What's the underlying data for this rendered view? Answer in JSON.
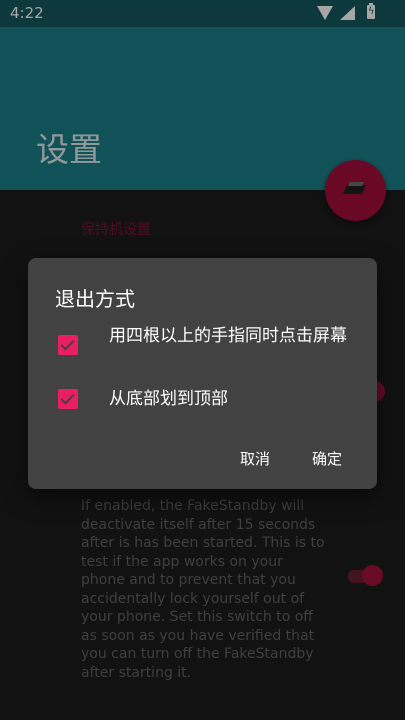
{
  "status_bar": {
    "time": "4:22"
  },
  "app_bar": {
    "title": "设置"
  },
  "background": {
    "section_header": "保持机设置",
    "description": "If enabled, the FakeStandby will deactivate itself after 15 seconds after is has been started. This is to test if the app works on your phone and to prevent that you accidentally lock yourself out of your phone. Set this switch to off as soon as you have verified that you can turn off the FakeStandby after starting it."
  },
  "dialog": {
    "title": "退出方式",
    "options": [
      {
        "label": "用四根以上的手指同时点击屏幕",
        "checked": true
      },
      {
        "label": "从底部划到顶部",
        "checked": true
      }
    ],
    "cancel_label": "取消",
    "ok_label": "确定"
  },
  "colors": {
    "primary_dark": "#15585f",
    "primary": "#1b7f88",
    "accent": "#e91e63",
    "fab": "#a10e3b",
    "dialog_bg": "#424242"
  }
}
